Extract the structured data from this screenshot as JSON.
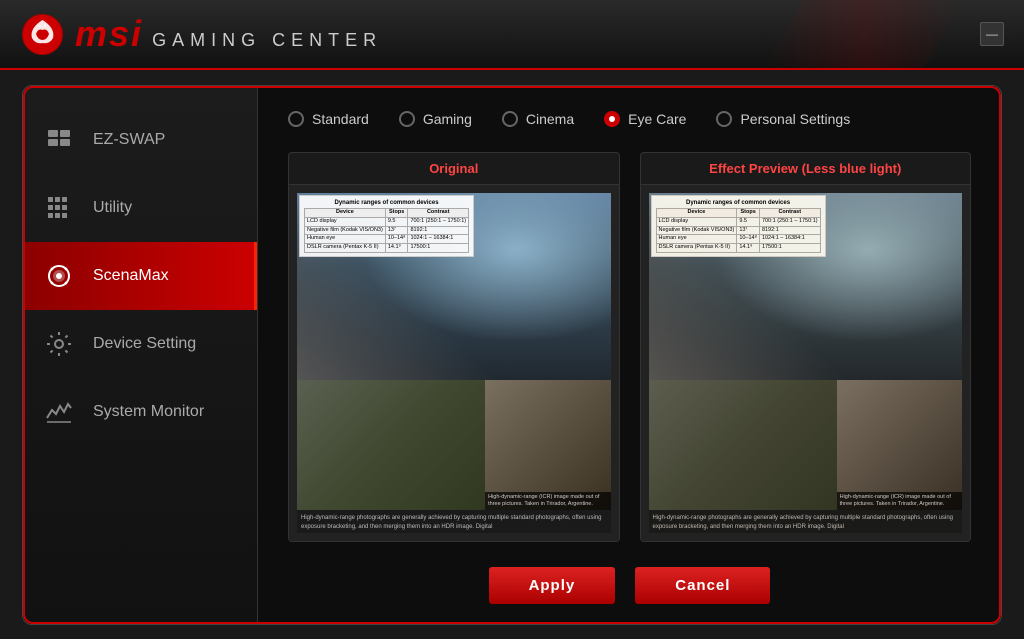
{
  "header": {
    "title": "MSI GAMING CENTER",
    "msi_label": "MSi",
    "gaming_center_label": "GAMING CENTER",
    "minimize_label": "—"
  },
  "sidebar": {
    "items": [
      {
        "id": "ez-swap",
        "label": "EZ-SWAP",
        "active": false
      },
      {
        "id": "utility",
        "label": "Utility",
        "active": false
      },
      {
        "id": "scenamax",
        "label": "ScenaMax",
        "active": true
      },
      {
        "id": "device-setting",
        "label": "Device Setting",
        "active": false
      },
      {
        "id": "system-monitor",
        "label": "System Monitor",
        "active": false
      }
    ]
  },
  "mode_selector": {
    "options": [
      {
        "id": "standard",
        "label": "Standard",
        "active": false
      },
      {
        "id": "gaming",
        "label": "Gaming",
        "active": false
      },
      {
        "id": "cinema",
        "label": "Cinema",
        "active": false
      },
      {
        "id": "eye-care",
        "label": "Eye Care",
        "active": true
      },
      {
        "id": "personal-settings",
        "label": "Personal Settings",
        "active": false
      }
    ]
  },
  "preview": {
    "original_label": "Original",
    "effect_label": "Effect Preview (Less blue light)"
  },
  "actions": {
    "apply_label": "Apply",
    "cancel_label": "Cancel"
  },
  "image_table": {
    "title": "Dynamic ranges of common devices",
    "headers": [
      "Device",
      "Stops",
      "Contrast"
    ],
    "rows": [
      [
        "LCD display",
        "9.5",
        "700:1 (250:1 – 1750:1)"
      ],
      [
        "Negative film (Kodak VIS/ON3)",
        "13⁽⁷⁾",
        "8192:1"
      ],
      [
        "Human eye",
        "10– 14⁽⁸⁾",
        "1024:1 – 16384:1"
      ],
      [
        "DSLR camera (Pentax K-5 II)",
        "14.1⁽⁹⁾",
        "17500:1"
      ]
    ]
  },
  "image_caption": "High-dynamic-range photographs are generally achieved by capturing multiple standard photographs, often using exposure bracketing, and then merging them into an HDR image. Digital",
  "image_caption2": "High-dynamic-range (ICR) image made out of three pictures. Taken in Trirador, Argentine."
}
